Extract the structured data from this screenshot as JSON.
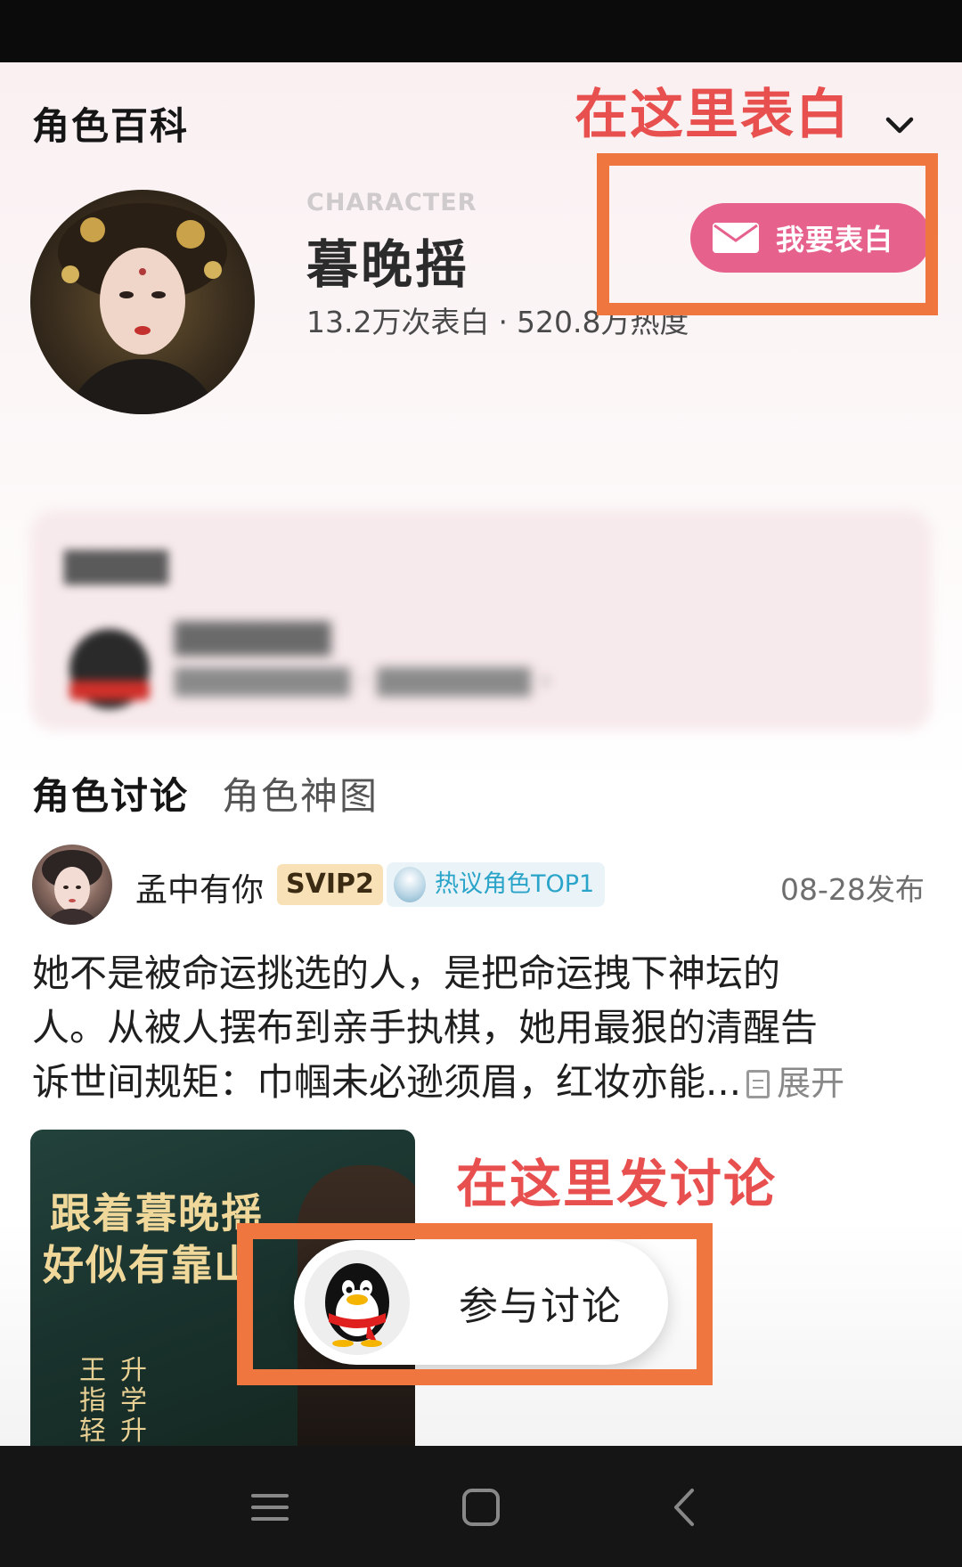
{
  "header": {
    "title": "角色百科"
  },
  "annotations": {
    "confess_hint": "在这里表白",
    "discuss_hint": "在这里发讨论"
  },
  "character": {
    "tag": "CHARACTER",
    "name": "暮晚摇",
    "stats_confessions": "13.2万次表白",
    "stats_separator": "·",
    "stats_heat": "520.8万热度",
    "confess_button": "我要表白"
  },
  "tabs": [
    {
      "label": "角色讨论",
      "active": true
    },
    {
      "label": "角色神图",
      "active": false
    }
  ],
  "post": {
    "username": "孟中有你",
    "vip_badge": "SVIP2",
    "hot_badge": "热议角色TOP1",
    "date": "08-28发布",
    "lines": [
      "她不是被命运挑选的人，是把命运拽下神坛的",
      "人。从被人摆布到亲手执棋，她用最狠的清醒告",
      "诉世间规矩：巾帼未必逊须眉，红妆亦能..."
    ],
    "expand_label": "展开",
    "image_text": {
      "line1": "跟着暮晚摇",
      "line2": "好似有靠山",
      "vertical1": "王指轻",
      "vertical2": "升学升"
    }
  },
  "join_button": "参与讨论",
  "colors": {
    "accent_pink": "#e6628c",
    "annotation_red": "#e8504f",
    "annotation_orange_box": "#f0763f",
    "svip_bg": "#f8e1b7",
    "hot_badge_text": "#2aa4c9"
  },
  "icons": [
    "chevron-down-icon",
    "mail-icon",
    "expand-icon",
    "qq-penguin-icon",
    "menu-icon",
    "home-icon",
    "back-icon"
  ]
}
